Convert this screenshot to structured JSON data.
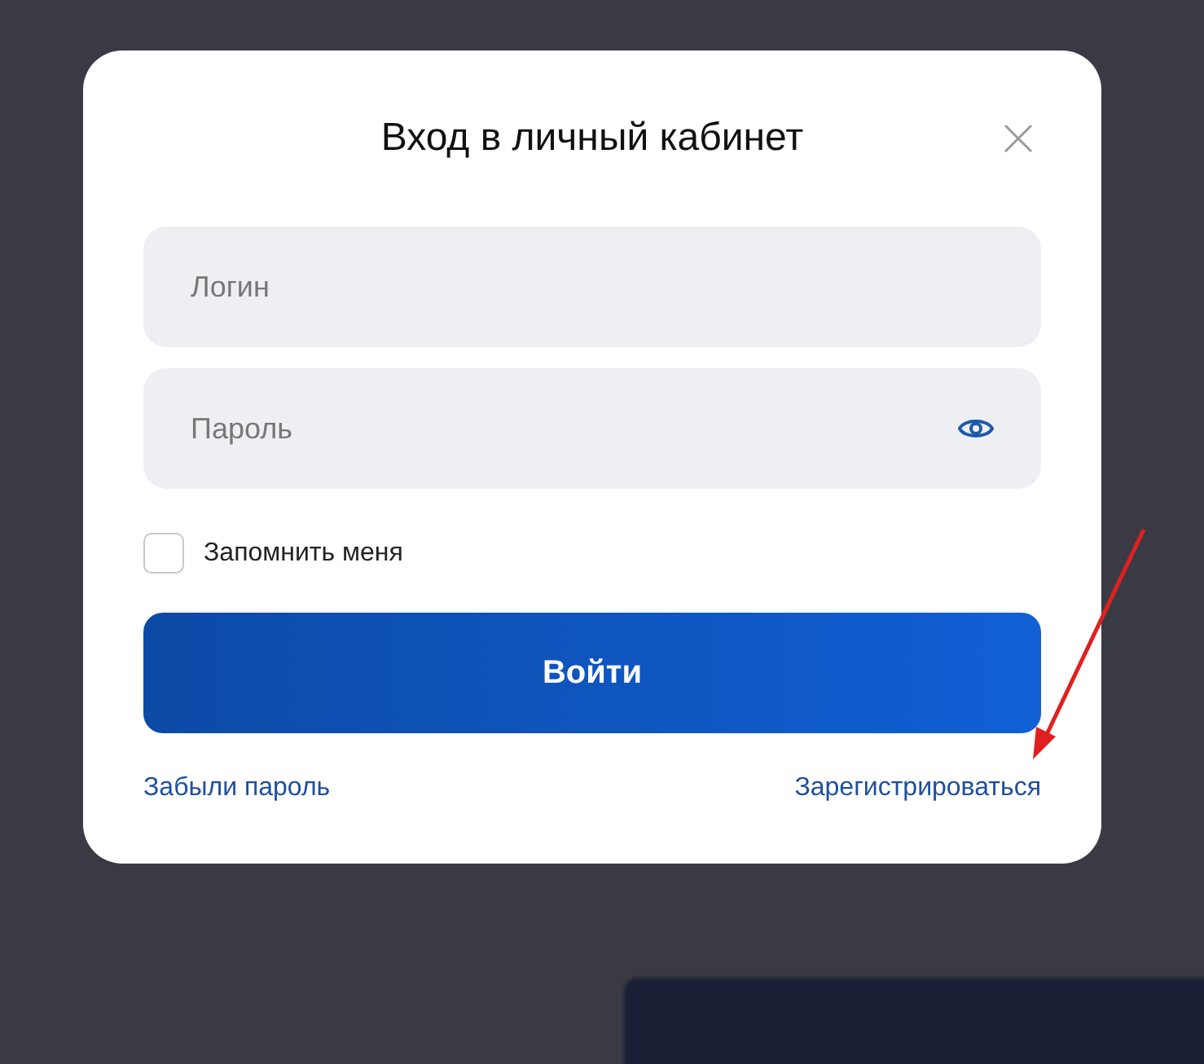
{
  "dialog": {
    "title": "Вход в личный кабинет"
  },
  "fields": [
    {
      "kind": "text",
      "placeholder": "Логин"
    },
    {
      "kind": "password",
      "placeholder": "Пароль"
    }
  ],
  "remember": {
    "label": "Запомнить меня",
    "checked": false
  },
  "submit": {
    "label": "Войти"
  },
  "links": [
    {
      "label": "Забыли пароль"
    },
    {
      "label": "Зарегистрироваться"
    }
  ]
}
